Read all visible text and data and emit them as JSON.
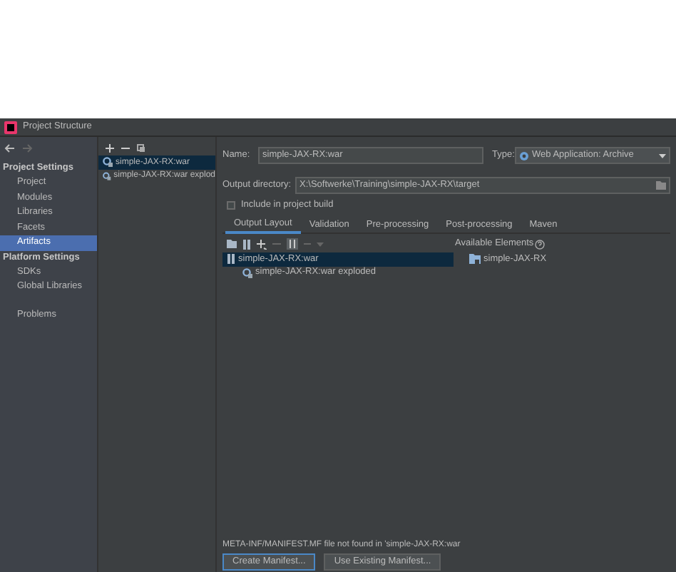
{
  "window": {
    "title": "Project Structure"
  },
  "sidebar": {
    "sections": [
      {
        "heading": "Project Settings",
        "items": [
          {
            "label": "Project",
            "selected": false
          },
          {
            "label": "Modules",
            "selected": false
          },
          {
            "label": "Libraries",
            "selected": false
          },
          {
            "label": "Facets",
            "selected": false
          },
          {
            "label": "Artifacts",
            "selected": true
          }
        ]
      },
      {
        "heading": "Platform Settings",
        "items": [
          {
            "label": "SDKs",
            "selected": false
          },
          {
            "label": "Global Libraries",
            "selected": false
          }
        ]
      }
    ],
    "problems": {
      "label": "Problems",
      "selected": false
    }
  },
  "artifacts": [
    {
      "label": "simple-JAX-RX:war",
      "selected": true
    },
    {
      "label": "simple-JAX-RX:war explod",
      "selected": false
    }
  ],
  "editor": {
    "name_label": "Name:",
    "name_value": "simple-JAX-RX:war",
    "type_label": "Type:",
    "type_value": "Web Application: Archive",
    "output_label": "Output directory:",
    "output_value": "X:\\Softwerke\\Training\\simple-JAX-RX\\target",
    "include_in_build": {
      "label": "Include in project build",
      "checked": false
    },
    "tabs": [
      {
        "label": "Output Layout",
        "selected": true
      },
      {
        "label": "Validation",
        "selected": false
      },
      {
        "label": "Pre-processing",
        "selected": false
      },
      {
        "label": "Post-processing",
        "selected": false
      },
      {
        "label": "Maven",
        "selected": false
      }
    ],
    "layout_tree": [
      {
        "label": "simple-JAX-RX:war",
        "kind": "archive",
        "selected": true,
        "children": [
          {
            "label": "simple-JAX-RX:war exploded",
            "kind": "artifact",
            "selected": false
          }
        ]
      }
    ],
    "available": {
      "heading": "Available Elements",
      "items": [
        {
          "label": "simple-JAX-RX",
          "kind": "module"
        }
      ]
    },
    "manifest": {
      "message": "META-INF/MANIFEST.MF file not found in 'simple-JAX-RX:war",
      "buttons": [
        {
          "label": "Create Manifest...",
          "focused": true
        },
        {
          "label": "Use Existing Manifest...",
          "focused": false
        }
      ]
    }
  }
}
